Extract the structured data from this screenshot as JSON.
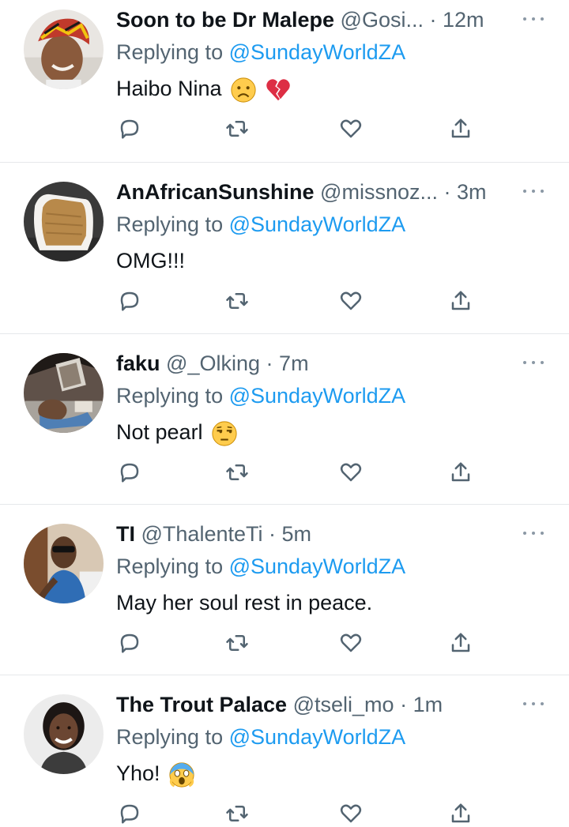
{
  "colors": {
    "text": "#0f1419",
    "secondary": "#536471",
    "link": "#1d9bf0",
    "divider": "#e6e8eb",
    "icon": "#536471"
  },
  "tweets": [
    {
      "display_name": "Soon to be Dr Malepe",
      "handle": "@Gosi...",
      "separator": "·",
      "time": "12m",
      "replying_prefix": "Replying to",
      "replying_handle": "@SundayWorldZA",
      "text": "Haibo Nina",
      "emojis": [
        "frowning-face",
        "broken-heart"
      ],
      "avatar": "avatar-man-red-hat"
    },
    {
      "display_name": "AnAfricanSunshine",
      "handle": "@missnoz...",
      "separator": "·",
      "time": "3m",
      "replying_prefix": "Replying to",
      "replying_handle": "@SundayWorldZA",
      "text": "OMG!!!",
      "emojis": [],
      "avatar": "avatar-bread-loaf"
    },
    {
      "display_name": "faku",
      "handle": "@_Olking",
      "separator": "·",
      "time": "7m",
      "replying_prefix": "Replying to",
      "replying_handle": "@SundayWorldZA",
      "text": "Not pearl",
      "emojis": [
        "unamused-face"
      ],
      "avatar": "avatar-man-lying"
    },
    {
      "display_name": "TI",
      "handle": "@ThalenteTi",
      "separator": "·",
      "time": "5m",
      "replying_prefix": "Replying to",
      "replying_handle": "@SundayWorldZA",
      "text": "May her soul rest in peace.",
      "emojis": [],
      "avatar": "avatar-man-sunglasses"
    },
    {
      "display_name": "The Trout Palace",
      "handle": "@tseli_mo",
      "separator": "·",
      "time": "1m",
      "replying_prefix": "Replying to",
      "replying_handle": "@SundayWorldZA",
      "text": "Yho!",
      "emojis": [
        "screaming-face"
      ],
      "avatar": "avatar-woman-smiling"
    }
  ],
  "action_icons": [
    "reply-icon",
    "retweet-icon",
    "like-icon",
    "share-icon"
  ]
}
